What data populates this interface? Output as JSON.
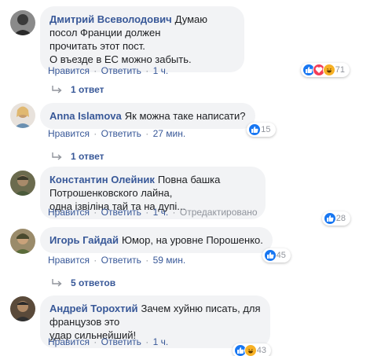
{
  "comments": [
    {
      "author": "Дмитрий Всеволодович",
      "text": "Думаю посол Франции должен\nпрочитать этот пост.\nО въезде в ЕС можно забыть.",
      "reaction_count": "71",
      "reaction_icons": [
        "like-icon",
        "love-icon",
        "haha-icon"
      ],
      "like_label": "Нравится",
      "reply_label": "Ответить",
      "time": "1 ч.",
      "replies_label": "1 ответ"
    },
    {
      "author": "Anna Islamova",
      "text": "Як можна таке написати?",
      "reaction_count": "15",
      "reaction_icons": [
        "like-icon"
      ],
      "like_label": "Нравится",
      "reply_label": "Ответить",
      "time": "27 мин.",
      "replies_label": "1 ответ"
    },
    {
      "author": "Константин Олейник",
      "text": "Повна башка Потрошенковского лайна,\nодна ізвіліна тай та на дупі...",
      "reaction_count": "28",
      "reaction_icons": [
        "like-icon"
      ],
      "like_label": "Нравится",
      "reply_label": "Ответить",
      "time": "1 ч.",
      "edited": "Отредактировано"
    },
    {
      "author": "Игорь Гайдай",
      "text": "Юмор, на уровне Порошенко.",
      "reaction_count": "45",
      "reaction_icons": [
        "like-icon"
      ],
      "like_label": "Нравится",
      "reply_label": "Ответить",
      "time": "59 мин.",
      "replies_label": "5 ответов"
    },
    {
      "author": "Андрей Торохтий",
      "text": "Зачем хуйню писать, для французов это\nудар сильнейший!",
      "reaction_count": "43",
      "reaction_icons": [
        "like-icon",
        "haha-icon"
      ],
      "like_label": "Нравится",
      "reply_label": "Ответить",
      "time": "1 ч."
    }
  ],
  "colors": {
    "author": "#385898",
    "bubble": "#f2f3f5",
    "meta": "#90949c",
    "like": "#1877f2",
    "love": "#f33e58",
    "haha": "#f7b125"
  }
}
